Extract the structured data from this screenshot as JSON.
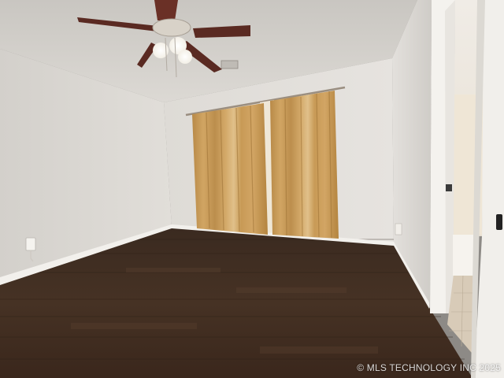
{
  "photo": {
    "subject": "empty bedroom with ceiling fan, gold curtains, dark wood-look floor, open doorway to bathroom",
    "colors": {
      "wall": "#e6e3df",
      "ceiling": "#d9d6d1",
      "floor": "#3b2a1f",
      "curtain": "#c79a55",
      "trim": "#f2f0ec",
      "fan_blade": "#5a2a22"
    }
  },
  "watermark": {
    "text": "© MLS TECHNOLOGY INC 2025"
  }
}
